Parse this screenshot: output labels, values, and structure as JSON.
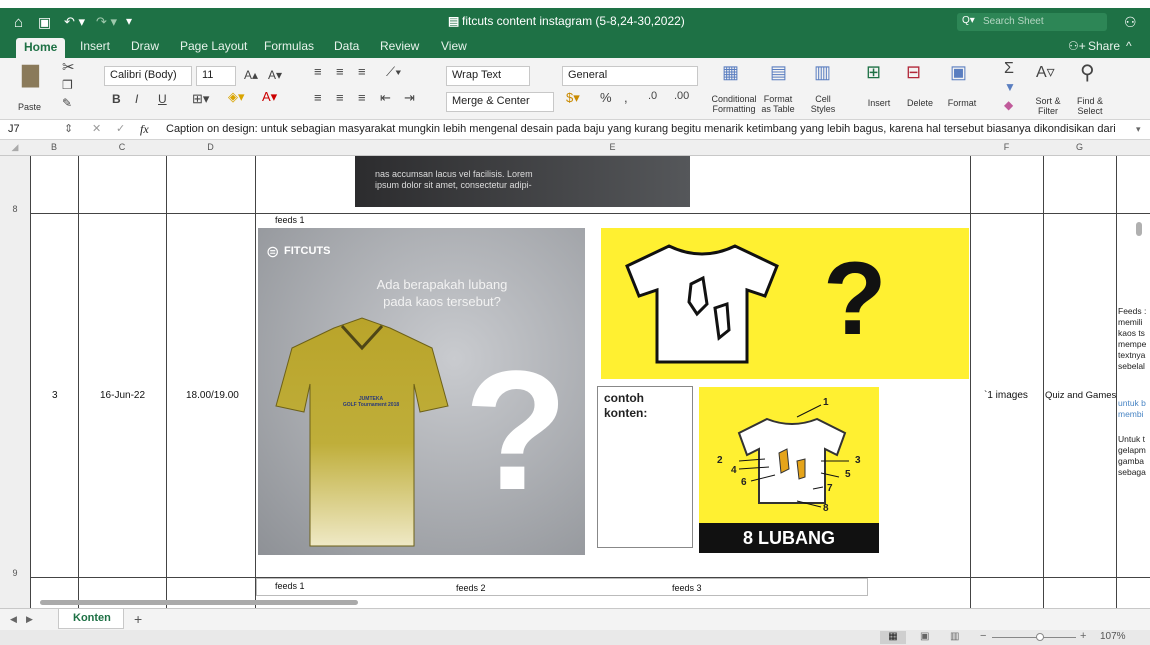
{
  "window": {
    "title": "fitcuts content instagram (5-8,24-30,2022)",
    "search_placeholder": "Search Sheet"
  },
  "tabs": [
    "Home",
    "Insert",
    "Draw",
    "Page Layout",
    "Formulas",
    "Data",
    "Review",
    "View"
  ],
  "share_label": "Share",
  "ribbon": {
    "paste": "Paste",
    "font_name": "Calibri (Body)",
    "font_size": "11",
    "bold": "B",
    "italic": "I",
    "underline": "U",
    "wrap_text": "Wrap Text",
    "merge_center": "Merge & Center",
    "number_format": "General",
    "conditional": "Conditional\nFormatting",
    "format_table": "Format\nas Table",
    "cell_styles": "Cell\nStyles",
    "insert": "Insert",
    "delete": "Delete",
    "format": "Format",
    "sort_filter": "Sort &\nFilter",
    "find_select": "Find &\nSelect"
  },
  "formula_bar": {
    "cell_ref": "J7",
    "formula": "Caption on design: untuk sebagian masyarakat mungkin lebih mengenal desain pada baju yang kurang begitu menarik ketimbang yang lebih bagus, karena hal tersebut biasanya dikondisikan dari"
  },
  "columns": [
    "B",
    "C",
    "D",
    "E",
    "F",
    "G"
  ],
  "rows": {
    "r8": "8",
    "r9": "9"
  },
  "cells": {
    "lorem": "nas accumsan lacus vel facilisis. Lorem\nipsum dolor sit amet, consectetur adipi-",
    "feeds_label": "feeds 1",
    "num": "3",
    "date": "16-Jun-22",
    "time": "18.00/19.00",
    "images": "`1 images",
    "category": "Quiz and Games",
    "contoh": "contoh\nkonten:",
    "right_text_1": "Feeds :\nmemili\nkaos ts\nmempe\ntextnya\nsebelal",
    "right_text_2": "untuk b\nmembi",
    "right_text_3": "Untuk t\ngelapm\ngamba\nsebaga",
    "bottom_feeds": [
      "feeds 1",
      "feeds 2",
      "feeds 3"
    ]
  },
  "design_1": {
    "brand": "FITCUTS",
    "question": "Ada berapakah lubang\npada kaos tersebut?",
    "mark": "?",
    "shirt_text": "JUMTEKA\nGOLF Tournament 2018"
  },
  "design_2": {
    "mark": "?"
  },
  "answer": {
    "labels": [
      "1",
      "2",
      "3",
      "4",
      "5",
      "6",
      "7",
      "8"
    ],
    "caption": "8 LUBANG"
  },
  "sheet_tab": "Konten",
  "add_sheet": "+",
  "zoom": "107%",
  "colors": {
    "excel_green": "#1e7145",
    "yellow": "#fff031",
    "gray": "#9ea1a6"
  }
}
